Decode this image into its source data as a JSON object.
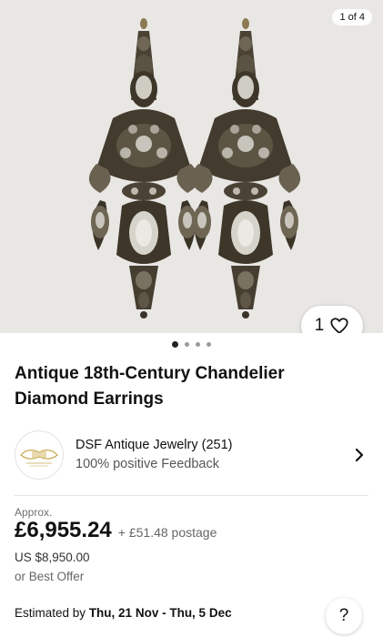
{
  "gallery": {
    "counter": "1 of 4",
    "watch_count": "1",
    "image_icon": "chandelier-earrings-photo",
    "dots_total": 4,
    "dots_active": 1
  },
  "listing": {
    "title": "Antique 18th-Century Chandelier Diamond Earrings"
  },
  "seller": {
    "name": "DSF Antique Jewelry (251)",
    "feedback": "100% positive Feedback",
    "logo_icon": "seller-logo-icon"
  },
  "pricing": {
    "approx_label": "Approx.",
    "price": "£6,955.24",
    "postage": "+ £51.48 postage",
    "usd_price": "US $8,950.00",
    "best_offer": "or Best Offer"
  },
  "delivery": {
    "prefix": "Estimated by",
    "dates": "Thu, 21 Nov - Thu, 5 Dec"
  },
  "help": {
    "label": "?"
  },
  "colors": {
    "gallery_bg": "#ebe9e6",
    "metal_dark": "#3b3528",
    "metal_mid": "#7c7361",
    "diamond": "#d8d6cf"
  }
}
